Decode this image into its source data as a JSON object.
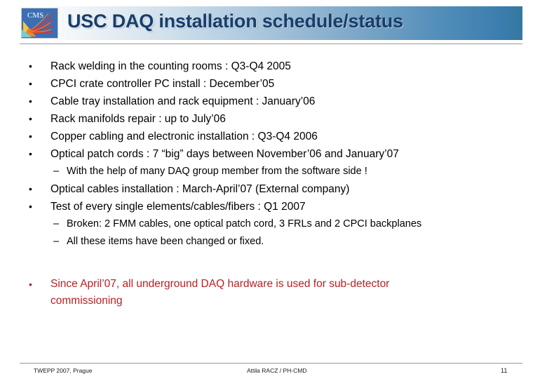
{
  "slide": {
    "title": "USC DAQ installation schedule/status",
    "logo_label": "CMS",
    "page_number": "11"
  },
  "colors": {
    "title_text": "#173e6b",
    "title_bar_gradient_end": "#35789f",
    "highlight_red": "#b81f22",
    "rule_gray": "#9a9a9a",
    "logo_blue": "#3b6fb5"
  },
  "bullets": [
    {
      "level": 1,
      "marker": "•",
      "text": "Rack welding in the counting rooms : Q3-Q4 2005"
    },
    {
      "level": 1,
      "marker": "•",
      "text": "CPCI crate controller PC install : December’05"
    },
    {
      "level": 1,
      "marker": "•",
      "text": "Cable tray installation and rack equipment : January’06"
    },
    {
      "level": 1,
      "marker": "•",
      "text": "Rack manifolds repair : up to July’06"
    },
    {
      "level": 1,
      "marker": "•",
      "text": "Copper cabling and electronic installation : Q3-Q4 2006"
    },
    {
      "level": 1,
      "marker": "•",
      "text": "Optical patch cords : 7 “big” days between November’06 and January’07"
    },
    {
      "level": 2,
      "marker": "–",
      "text": "With the help of many DAQ group member from the software side !"
    },
    {
      "level": 1,
      "marker": "•",
      "text": "Optical cables installation : March-April’07 (External company)"
    },
    {
      "level": 1,
      "marker": "•",
      "text": "Test of every single elements/cables/fibers : Q1 2007"
    },
    {
      "level": 2,
      "marker": "–",
      "text": "Broken: 2 FMM cables, one optical patch cord, 3 FRLs and 2 CPCI backplanes"
    },
    {
      "level": 2,
      "marker": "–",
      "text": "All these items have been changed or fixed."
    }
  ],
  "highlight": {
    "marker": "•",
    "text": "Since April’07, all underground DAQ hardware is used for sub-detector commissioning"
  },
  "footer": {
    "left": "TWEPP 2007, Prague",
    "center": "Attila RACZ / PH-CMD",
    "right": "11"
  }
}
